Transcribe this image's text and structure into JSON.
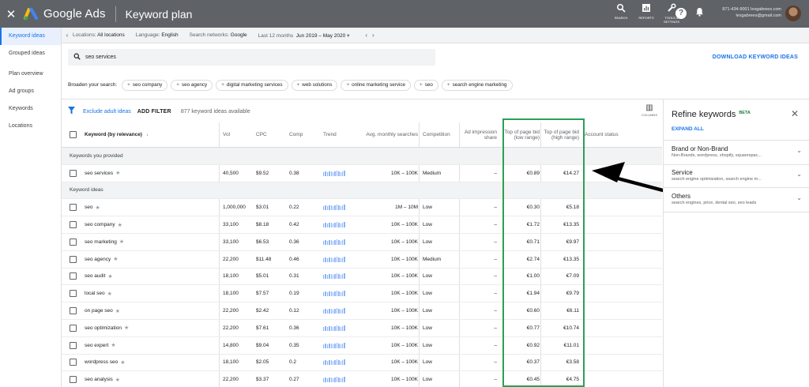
{
  "app": {
    "close_icon": "close-icon",
    "brand": "Google Ads",
    "page": "Keyword plan",
    "tools": [
      {
        "icon": "search-icon",
        "label": "SEARCH"
      },
      {
        "icon": "reports-icon",
        "label": "REPORTS"
      },
      {
        "icon": "wrench-icon",
        "label": "TOOLS & SETTINGS"
      }
    ],
    "account_line1": "871-434-9001 lexgabrees.com",
    "account_line2": "lexgabrees@gmail.com"
  },
  "sidebar": {
    "items": [
      {
        "label": "Keyword ideas",
        "active": true
      },
      {
        "label": "Grouped ideas",
        "active": false
      },
      {
        "label": "Plan overview",
        "active": false
      },
      {
        "label": "Ad groups",
        "active": false
      },
      {
        "label": "Keywords",
        "active": false
      },
      {
        "label": "Locations",
        "active": false
      }
    ]
  },
  "filters": {
    "locations_label": "Locations:",
    "locations_value": "All locations",
    "language_label": "Language:",
    "language_value": "English",
    "networks_label": "Search networks:",
    "networks_value": "Google",
    "range_label": "Last 12 months",
    "range_value": "Jun 2019 – May 2020"
  },
  "search": {
    "value": "seo services",
    "download": "DOWNLOAD KEYWORD IDEAS"
  },
  "broaden": {
    "label": "Broaden your search:",
    "chips": [
      "seo company",
      "seo agency",
      "digital marketing services",
      "web solutions",
      "online marketing service",
      "seo",
      "search engine marketing"
    ]
  },
  "table_tools": {
    "exclude": "Exclude adult ideas",
    "add_filter": "ADD FILTER",
    "count": "877 keyword ideas available",
    "columns": "COLUMNS"
  },
  "table": {
    "headers": {
      "keyword": "Keyword (by relevance)",
      "vol": "Vol",
      "cpc": "CPC",
      "comp": "Comp",
      "trend": "Trend",
      "avg": "Avg. monthly searches",
      "competition": "Competition",
      "impression": "Ad impression share",
      "low": "Top of page bid (low range)",
      "high": "Top of page bid (high range)",
      "account": "Account status"
    },
    "group1": "Keywords you provided",
    "provided": [
      {
        "keyword": "seo services",
        "vol": "40,500",
        "cpc": "$9.52",
        "comp": "0.38",
        "avg": "10K – 100K",
        "competition": "Medium",
        "impression": "–",
        "low": "€0.89",
        "high": "€14.27"
      }
    ],
    "group2": "Keyword ideas",
    "ideas": [
      {
        "keyword": "seo",
        "vol": "1,000,000",
        "cpc": "$3.01",
        "comp": "0.22",
        "avg": "1M – 10M",
        "competition": "Low",
        "impression": "–",
        "low": "€0.30",
        "high": "€5.18"
      },
      {
        "keyword": "seo company",
        "vol": "33,100",
        "cpc": "$8.18",
        "comp": "0.42",
        "avg": "10K – 100K",
        "competition": "Low",
        "impression": "–",
        "low": "€1.72",
        "high": "€13.35"
      },
      {
        "keyword": "seo marketing",
        "vol": "33,100",
        "cpc": "$6.53",
        "comp": "0.36",
        "avg": "10K – 100K",
        "competition": "Low",
        "impression": "–",
        "low": "€0.71",
        "high": "€9.97"
      },
      {
        "keyword": "seo agency",
        "vol": "22,200",
        "cpc": "$11.48",
        "comp": "0.46",
        "avg": "10K – 100K",
        "competition": "Medium",
        "impression": "–",
        "low": "€2.74",
        "high": "€13.35"
      },
      {
        "keyword": "seo audit",
        "vol": "18,100",
        "cpc": "$5.01",
        "comp": "0.31",
        "avg": "10K – 100K",
        "competition": "Low",
        "impression": "–",
        "low": "€1.00",
        "high": "€7.09"
      },
      {
        "keyword": "local seo",
        "vol": "18,100",
        "cpc": "$7.57",
        "comp": "0.19",
        "avg": "10K – 100K",
        "competition": "Low",
        "impression": "–",
        "low": "€1.94",
        "high": "€9.79"
      },
      {
        "keyword": "on page seo",
        "vol": "22,200",
        "cpc": "$2.42",
        "comp": "0.12",
        "avg": "10K – 100K",
        "competition": "Low",
        "impression": "–",
        "low": "€0.60",
        "high": "€6.11"
      },
      {
        "keyword": "seo optimization",
        "vol": "22,200",
        "cpc": "$7.61",
        "comp": "0.36",
        "avg": "10K – 100K",
        "competition": "Low",
        "impression": "–",
        "low": "€0.77",
        "high": "€10.74"
      },
      {
        "keyword": "seo expert",
        "vol": "14,800",
        "cpc": "$9.04",
        "comp": "0.35",
        "avg": "10K – 100K",
        "competition": "Low",
        "impression": "–",
        "low": "€0.92",
        "high": "€11.01"
      },
      {
        "keyword": "wordpress seo",
        "vol": "18,100",
        "cpc": "$2.05",
        "comp": "0.2",
        "avg": "10K – 100K",
        "competition": "Low",
        "impression": "–",
        "low": "€0.37",
        "high": "€3.58"
      },
      {
        "keyword": "seo analysis",
        "vol": "22,200",
        "cpc": "$3.37",
        "comp": "0.27",
        "avg": "10K – 100K",
        "competition": "Low",
        "impression": "–",
        "low": "€0.45",
        "high": "€4.75"
      }
    ]
  },
  "refine": {
    "title": "Refine keywords",
    "beta": "BETA",
    "expand_all": "EXPAND ALL",
    "sections": [
      {
        "name": "Brand or Non-Brand",
        "desc": "Non-Brands, wordpress, shopify, squarespac..."
      },
      {
        "name": "Service",
        "desc": "search engine optimization, search engine m..."
      },
      {
        "name": "Others",
        "desc": "search engines, price, dental seo, seo leads"
      }
    ]
  },
  "colors": {
    "topbar": "#5f6368",
    "accent": "#1a73e8",
    "highlight": "#2e9e55"
  }
}
